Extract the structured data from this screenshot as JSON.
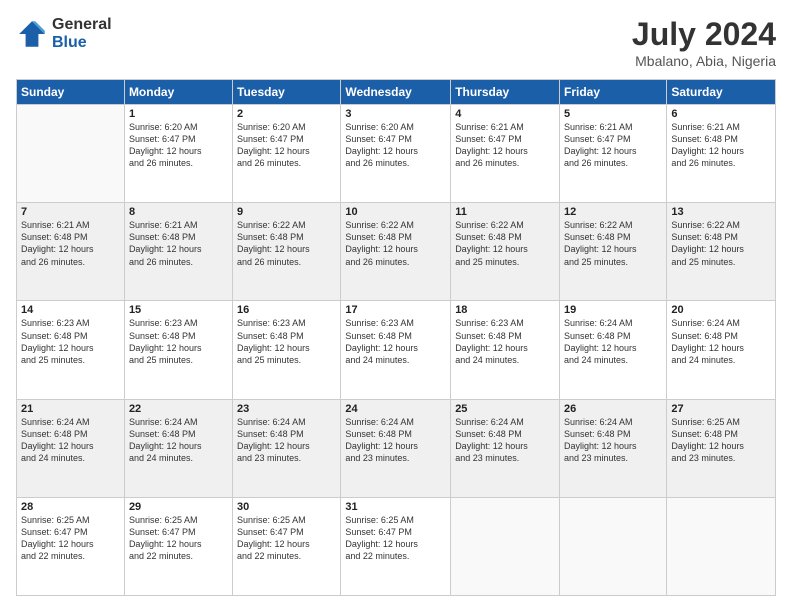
{
  "logo": {
    "general": "General",
    "blue": "Blue"
  },
  "title": "July 2024",
  "subtitle": "Mbalano, Abia, Nigeria",
  "headers": [
    "Sunday",
    "Monday",
    "Tuesday",
    "Wednesday",
    "Thursday",
    "Friday",
    "Saturday"
  ],
  "weeks": [
    [
      {
        "day": "",
        "info": ""
      },
      {
        "day": "1",
        "info": "Sunrise: 6:20 AM\nSunset: 6:47 PM\nDaylight: 12 hours\nand 26 minutes."
      },
      {
        "day": "2",
        "info": "Sunrise: 6:20 AM\nSunset: 6:47 PM\nDaylight: 12 hours\nand 26 minutes."
      },
      {
        "day": "3",
        "info": "Sunrise: 6:20 AM\nSunset: 6:47 PM\nDaylight: 12 hours\nand 26 minutes."
      },
      {
        "day": "4",
        "info": "Sunrise: 6:21 AM\nSunset: 6:47 PM\nDaylight: 12 hours\nand 26 minutes."
      },
      {
        "day": "5",
        "info": "Sunrise: 6:21 AM\nSunset: 6:47 PM\nDaylight: 12 hours\nand 26 minutes."
      },
      {
        "day": "6",
        "info": "Sunrise: 6:21 AM\nSunset: 6:48 PM\nDaylight: 12 hours\nand 26 minutes."
      }
    ],
    [
      {
        "day": "7",
        "info": "Sunrise: 6:21 AM\nSunset: 6:48 PM\nDaylight: 12 hours\nand 26 minutes."
      },
      {
        "day": "8",
        "info": "Sunrise: 6:21 AM\nSunset: 6:48 PM\nDaylight: 12 hours\nand 26 minutes."
      },
      {
        "day": "9",
        "info": "Sunrise: 6:22 AM\nSunset: 6:48 PM\nDaylight: 12 hours\nand 26 minutes."
      },
      {
        "day": "10",
        "info": "Sunrise: 6:22 AM\nSunset: 6:48 PM\nDaylight: 12 hours\nand 26 minutes."
      },
      {
        "day": "11",
        "info": "Sunrise: 6:22 AM\nSunset: 6:48 PM\nDaylight: 12 hours\nand 25 minutes."
      },
      {
        "day": "12",
        "info": "Sunrise: 6:22 AM\nSunset: 6:48 PM\nDaylight: 12 hours\nand 25 minutes."
      },
      {
        "day": "13",
        "info": "Sunrise: 6:22 AM\nSunset: 6:48 PM\nDaylight: 12 hours\nand 25 minutes."
      }
    ],
    [
      {
        "day": "14",
        "info": "Sunrise: 6:23 AM\nSunset: 6:48 PM\nDaylight: 12 hours\nand 25 minutes."
      },
      {
        "day": "15",
        "info": "Sunrise: 6:23 AM\nSunset: 6:48 PM\nDaylight: 12 hours\nand 25 minutes."
      },
      {
        "day": "16",
        "info": "Sunrise: 6:23 AM\nSunset: 6:48 PM\nDaylight: 12 hours\nand 25 minutes."
      },
      {
        "day": "17",
        "info": "Sunrise: 6:23 AM\nSunset: 6:48 PM\nDaylight: 12 hours\nand 24 minutes."
      },
      {
        "day": "18",
        "info": "Sunrise: 6:23 AM\nSunset: 6:48 PM\nDaylight: 12 hours\nand 24 minutes."
      },
      {
        "day": "19",
        "info": "Sunrise: 6:24 AM\nSunset: 6:48 PM\nDaylight: 12 hours\nand 24 minutes."
      },
      {
        "day": "20",
        "info": "Sunrise: 6:24 AM\nSunset: 6:48 PM\nDaylight: 12 hours\nand 24 minutes."
      }
    ],
    [
      {
        "day": "21",
        "info": "Sunrise: 6:24 AM\nSunset: 6:48 PM\nDaylight: 12 hours\nand 24 minutes."
      },
      {
        "day": "22",
        "info": "Sunrise: 6:24 AM\nSunset: 6:48 PM\nDaylight: 12 hours\nand 24 minutes."
      },
      {
        "day": "23",
        "info": "Sunrise: 6:24 AM\nSunset: 6:48 PM\nDaylight: 12 hours\nand 23 minutes."
      },
      {
        "day": "24",
        "info": "Sunrise: 6:24 AM\nSunset: 6:48 PM\nDaylight: 12 hours\nand 23 minutes."
      },
      {
        "day": "25",
        "info": "Sunrise: 6:24 AM\nSunset: 6:48 PM\nDaylight: 12 hours\nand 23 minutes."
      },
      {
        "day": "26",
        "info": "Sunrise: 6:24 AM\nSunset: 6:48 PM\nDaylight: 12 hours\nand 23 minutes."
      },
      {
        "day": "27",
        "info": "Sunrise: 6:25 AM\nSunset: 6:48 PM\nDaylight: 12 hours\nand 23 minutes."
      }
    ],
    [
      {
        "day": "28",
        "info": "Sunrise: 6:25 AM\nSunset: 6:47 PM\nDaylight: 12 hours\nand 22 minutes."
      },
      {
        "day": "29",
        "info": "Sunrise: 6:25 AM\nSunset: 6:47 PM\nDaylight: 12 hours\nand 22 minutes."
      },
      {
        "day": "30",
        "info": "Sunrise: 6:25 AM\nSunset: 6:47 PM\nDaylight: 12 hours\nand 22 minutes."
      },
      {
        "day": "31",
        "info": "Sunrise: 6:25 AM\nSunset: 6:47 PM\nDaylight: 12 hours\nand 22 minutes."
      },
      {
        "day": "",
        "info": ""
      },
      {
        "day": "",
        "info": ""
      },
      {
        "day": "",
        "info": ""
      }
    ]
  ]
}
